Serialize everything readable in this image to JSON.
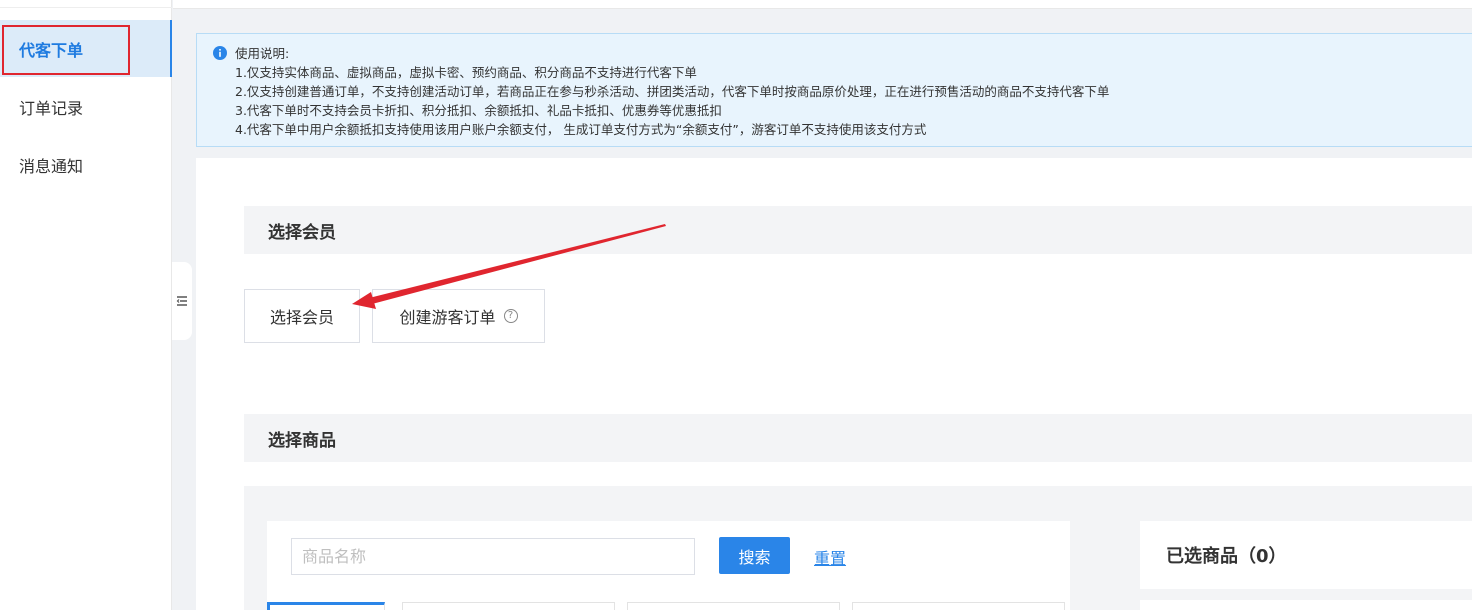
{
  "sidebar": {
    "items": [
      {
        "label": "代客下单",
        "active": true
      },
      {
        "label": "订单记录",
        "active": false
      },
      {
        "label": "消息通知",
        "active": false
      }
    ]
  },
  "notice": {
    "title": "使用说明:",
    "lines": [
      "1.仅支持实体商品、虚拟商品，虚拟卡密、预约商品、积分商品不支持进行代客下单",
      "2.仅支持创建普通订单，不支持创建活动订单，若商品正在参与秒杀活动、拼团类活动，代客下单时按商品原价处理，正在进行预售活动的商品不支持代客下单",
      "3.代客下单时不支持会员卡折扣、积分抵扣、余额抵扣、礼品卡抵扣、优惠券等优惠抵扣",
      "4.代客下单中用户余额抵扣支持使用该用户账户余额支付， 生成订单支付方式为“余额支付”，游客订单不支持使用该支付方式"
    ]
  },
  "member_section": {
    "title": "选择会员",
    "select_member_label": "选择会员",
    "guest_order_label": "创建游客订单",
    "help_icon": "?"
  },
  "goods_section": {
    "title": "选择商品",
    "search_placeholder": "商品名称",
    "search_value": "",
    "search_label": "搜索",
    "reset_label": "重置",
    "selected_title": "已选商品（0）"
  },
  "colors": {
    "accent": "#2a85e8",
    "annotation_red": "#e0262f"
  }
}
